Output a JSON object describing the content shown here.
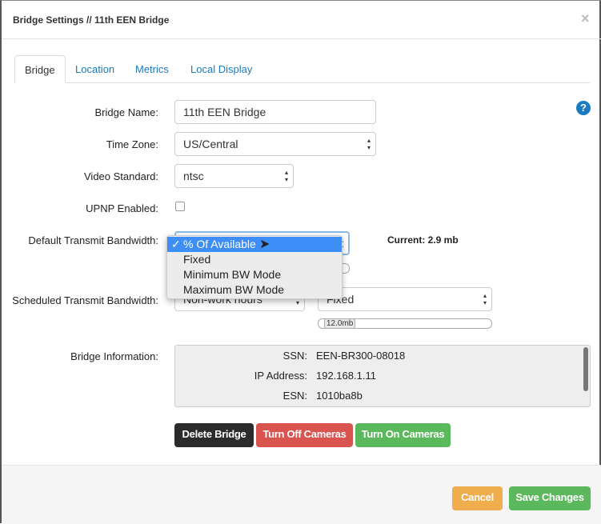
{
  "dialog": {
    "title": "Bridge Settings // 11th EEN Bridge",
    "close_icon": "close-icon"
  },
  "tabs": [
    {
      "label": "Bridge",
      "active": true
    },
    {
      "label": "Location"
    },
    {
      "label": "Metrics"
    },
    {
      "label": "Local Display"
    }
  ],
  "form": {
    "bridge_name": {
      "label": "Bridge Name:",
      "value": "11th EEN Bridge"
    },
    "time_zone": {
      "label": "Time Zone:",
      "value": "US/Central"
    },
    "video_standard": {
      "label": "Video Standard:",
      "value": "ntsc"
    },
    "upnp": {
      "label": "UPNP Enabled:",
      "checked": false
    },
    "default_bw": {
      "label": "Default Transmit Bandwidth:",
      "current": "Current: 2.9 mb",
      "options": [
        "% Of Available",
        "Fixed",
        "Minimum BW Mode",
        "Maximum BW Mode"
      ],
      "selected": "% Of Available"
    },
    "scheduled_bw": {
      "label": "Scheduled Transmit Bandwidth:",
      "schedule": "Non-work hours",
      "mode": "Fixed",
      "slider_value": "12.0mb"
    },
    "bridge_info": {
      "label": "Bridge Information:",
      "rows": [
        {
          "k": "SSN:",
          "v": "EEN-BR300-08018"
        },
        {
          "k": "IP Address:",
          "v": "192.168.1.11"
        },
        {
          "k": "ESN:",
          "v": "1010ba8b"
        }
      ]
    }
  },
  "actions": {
    "delete": "Delete Bridge",
    "off": "Turn Off Cameras",
    "on": "Turn On Cameras"
  },
  "footer": {
    "cancel": "Cancel",
    "save": "Save Changes"
  },
  "help": "?",
  "colors": {
    "link": "#1a7bc0",
    "danger": "#d9534f",
    "success": "#5cb85c",
    "warning": "#f0ad4e",
    "dark": "#333333",
    "menu_highlight": "#3d8ef7"
  }
}
